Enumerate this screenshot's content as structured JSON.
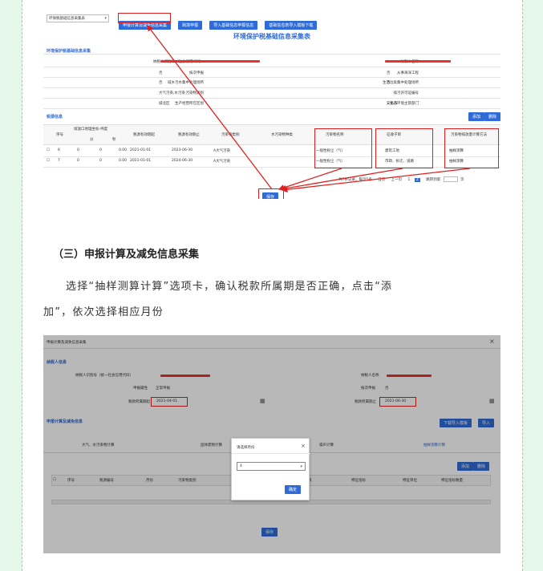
{
  "screenshot1": {
    "dropdown": "环保税基础信息采集表",
    "buttons": [
      "申报计算及减免信息采集",
      "跨境申报",
      "导入基础信息申报信息",
      "基础信息表导入模板下载"
    ],
    "title": "环境保护税基础信息采集表",
    "section1": "环境保护税基础信息采集",
    "fields_left": [
      {
        "label": "纳税人识别号（社会信用代码）",
        "value": ""
      },
      {
        "label": "按次申报",
        "value": "否"
      },
      {
        "label": "城乡污水集中处理场所",
        "value": "否"
      },
      {
        "label": "污染物类别",
        "value": "大气污染,水污染"
      },
      {
        "label": "生产经营所在区划",
        "value": "城北区"
      }
    ],
    "fields_right": [
      {
        "label": "纳税人名称",
        "value": ""
      },
      {
        "label": "从事海洋工程",
        "value": "否"
      },
      {
        "label": "生活垃圾集中处理场所",
        "value": "否"
      },
      {
        "label": "排污许可证编号",
        "value": ""
      },
      {
        "label": "生态环境主管部门",
        "value": "安乐市"
      }
    ],
    "section2": "税源信息",
    "add": "添加",
    "delete": "删除",
    "columns": [
      "序号",
      "排放口地理坐标-纬度",
      "税源有效期起",
      "税源有效期止",
      "污染物类别",
      "水污染物种类",
      "污染物名称",
      "征收子目",
      "污染物排放量计算方法"
    ],
    "subcolumns": [
      "分",
      "秒"
    ],
    "rows": [
      {
        "no": "6",
        "a": "0",
        "b": "0",
        "c": "0.00",
        "start": "2021-01-01",
        "end": "2023-06-30",
        "cat": "A大气污染",
        "name": "一般性粉尘（气）",
        "item": "建筑工地",
        "method": "抽样测算"
      },
      {
        "no": "7",
        "a": "0",
        "b": "0",
        "c": "0.00",
        "start": "2021-01-01",
        "end": "2024-06-30",
        "cat": "A大气污染",
        "name": "一般性粉尘（气）",
        "item": "市政、拆迁、道路",
        "method": "抽样测算"
      }
    ],
    "pager": "共7条记录，每页5条",
    "pager_first": "首页",
    "pager_prev": "上一页",
    "pager_pages": [
      "1",
      "2"
    ],
    "pager_jump": "跳转到第",
    "pager_unit": "页",
    "save": "保存"
  },
  "heading": "（三）申报计算及减免信息采集",
  "paragraph_line1": "选择“抽样测算计算”选项卡，确认税款所属期是否正确，点击“添",
  "paragraph_line2": "加”，依次选择相应月份",
  "screenshot2": {
    "window_title": "申报计算及减免信息采集",
    "close": "×",
    "section1": "纳税人信息",
    "id_label": "纳税人识别号（统一社会信用代码）",
    "name_label": "纳税人名称",
    "attr_label": "申报属性",
    "attr_value": "正常申报",
    "byci_label": "按次申报",
    "byci_value": "否",
    "period_start_label": "税款所属期起",
    "period_start": "2021-04-01",
    "period_end_label": "税款所属期止",
    "period_end": "2021-06-30",
    "section2": "申报计算及减免信息",
    "btn_download": "下载导入模板",
    "btn_import": "导入",
    "tabs": [
      "大气、水污染物计算",
      "固体废物计算",
      "噪声计算",
      "抽样测算计算"
    ],
    "add": "添加",
    "delete": "删除",
    "columns": [
      "序号",
      "税源编号",
      "月份",
      "污染物类别",
      "污染物名称",
      "特征指标",
      "特征单位",
      "特征指标数量"
    ],
    "modal_title": "请选择月份",
    "modal_close": "×",
    "modal_value": "4",
    "modal_ok": "确定",
    "save": "保存"
  }
}
